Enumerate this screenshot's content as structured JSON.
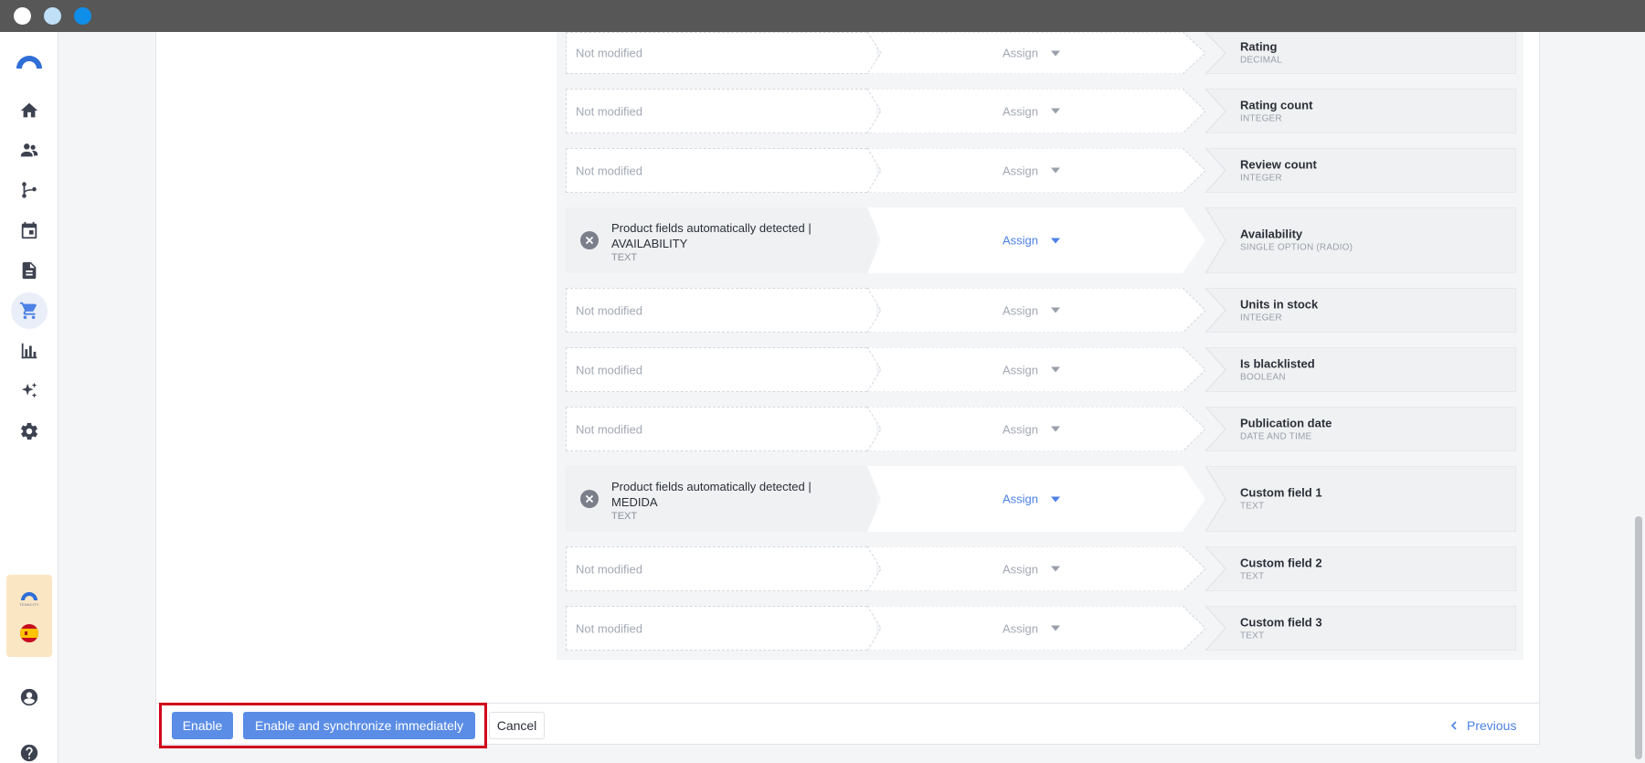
{
  "sidebar": {
    "items": [
      {
        "name": "home-icon"
      },
      {
        "name": "contacts-icon"
      },
      {
        "name": "automation-icon"
      },
      {
        "name": "calendar-icon"
      },
      {
        "name": "document-icon"
      },
      {
        "name": "cart-icon",
        "active": true
      },
      {
        "name": "chart-icon"
      },
      {
        "name": "sparkles-icon"
      },
      {
        "name": "gear-icon"
      }
    ],
    "account_logo_text": "TENACITY"
  },
  "mapping": {
    "rows": [
      {
        "source": "Not modified",
        "assign": "Assign",
        "field": "Rating",
        "type": "DECIMAL"
      },
      {
        "source": "Not modified",
        "assign": "Assign",
        "field": "Rating count",
        "type": "INTEGER"
      },
      {
        "source": "Not modified",
        "assign": "Assign",
        "field": "Review count",
        "type": "INTEGER"
      },
      {
        "source": "Product fields automatically detected | AVAILABILITY",
        "source_type": "TEXT",
        "assign": "Assign",
        "field": "Availability",
        "type": "SINGLE OPTION (RADIO)"
      },
      {
        "source": "Not modified",
        "assign": "Assign",
        "field": "Units in stock",
        "type": "INTEGER"
      },
      {
        "source": "Not modified",
        "assign": "Assign",
        "field": "Is blacklisted",
        "type": "BOOLEAN"
      },
      {
        "source": "Not modified",
        "assign": "Assign",
        "field": "Publication date",
        "type": "DATE AND TIME"
      },
      {
        "source": "Product fields automatically detected | MEDIDA",
        "source_type": "TEXT",
        "assign": "Assign",
        "field": "Custom field 1",
        "type": "TEXT"
      },
      {
        "source": "Not modified",
        "assign": "Assign",
        "field": "Custom field 2",
        "type": "TEXT"
      },
      {
        "source": "Not modified",
        "assign": "Assign",
        "field": "Custom field 3",
        "type": "TEXT"
      }
    ]
  },
  "footer": {
    "enable_label": "Enable",
    "enable_sync_label": "Enable and synchronize immediately",
    "cancel_label": "Cancel",
    "previous_label": "Previous"
  },
  "colors": {
    "accent": "#4d81e6",
    "primary_button": "#5b8de6",
    "highlight": "#d0021b"
  }
}
